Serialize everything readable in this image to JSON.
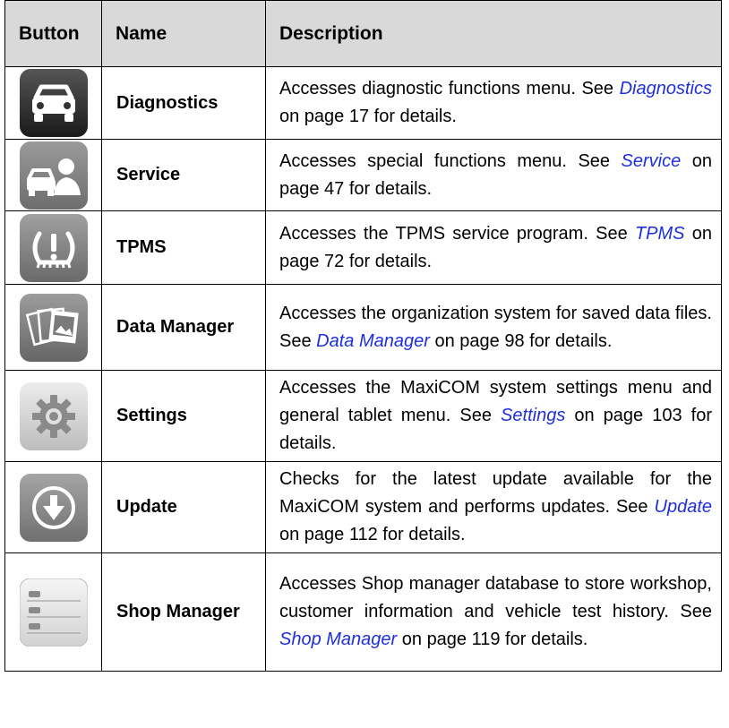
{
  "headers": {
    "button": "Button",
    "name": "Name",
    "description": "Description"
  },
  "rows": [
    {
      "name": "Diagnostics",
      "icon": "car-icon",
      "desc_before": "Accesses diagnostic functions menu. See ",
      "link": "Diagnostics",
      "desc_after": " on page 17 for details."
    },
    {
      "name": "Service",
      "icon": "car-mechanic-icon",
      "desc_before": "Accesses special functions menu. See ",
      "link": "Service",
      "desc_after": " on page 47 for details."
    },
    {
      "name": "TPMS",
      "icon": "tire-pressure-icon",
      "desc_before": "Accesses the TPMS service program. See ",
      "link": "TPMS",
      "desc_after": " on page 72 for details."
    },
    {
      "name": "Data Manager",
      "icon": "photo-gallery-icon",
      "desc_before": "Accesses the organization system for saved data files. See ",
      "link": "Data Manager",
      "desc_after": " on page 98 for details."
    },
    {
      "name": "Settings",
      "icon": "gear-icon",
      "desc_before": "Accesses the MaxiCOM system settings menu and general tablet menu. See ",
      "link": "Settings",
      "desc_after": " on page 103 for details."
    },
    {
      "name": "Update",
      "icon": "download-arrow-icon",
      "desc_before": "Checks for the latest update available for the MaxiCOM system and performs updates. See ",
      "link": "Update",
      "desc_after": " on page 112 for details."
    },
    {
      "name": "Shop Manager",
      "icon": "car-list-icon",
      "desc_before": "Accesses Shop manager database to store workshop, customer information and vehicle test history. See ",
      "link": "Shop Manager",
      "desc_after": " on page 119 for details."
    }
  ],
  "colors": {
    "link": "#1f2fdc",
    "header_bg": "#d9d9d9"
  }
}
